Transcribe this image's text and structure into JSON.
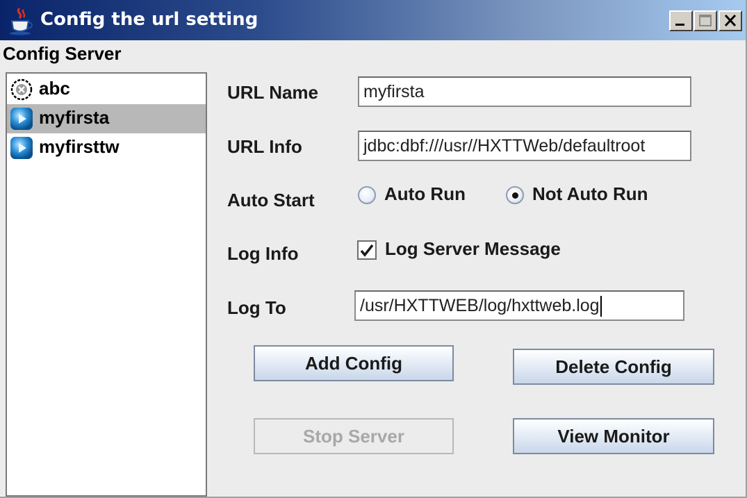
{
  "window": {
    "title": "Config the url setting",
    "icon": "java-cup-icon"
  },
  "server_panel": {
    "label": "Config Server",
    "items": [
      {
        "label": "abc",
        "icon": "stopped-server-icon",
        "selected": false
      },
      {
        "label": "myfirsta",
        "icon": "running-server-icon",
        "selected": true
      },
      {
        "label": "myfirsttw",
        "icon": "running-server-icon",
        "selected": false
      }
    ]
  },
  "form": {
    "url_name_label": "URL Name",
    "url_name_value": "myfirsta",
    "url_info_label": "URL Info",
    "url_info_value": "jdbc:dbf:///usr//HXTTWeb/defaultroot",
    "auto_start_label": "Auto Start",
    "auto_run_label": "Auto Run",
    "not_auto_run_label": "Not Auto Run",
    "auto_start_selected": "Not Auto Run",
    "log_info_label": "Log Info",
    "log_server_message_label": "Log Server Message",
    "log_server_message_checked": true,
    "log_to_label": "Log To",
    "log_to_value": "/usr/HXTTWEB/log/hxttweb.log"
  },
  "buttons": {
    "add_config": "Add Config",
    "delete_config": "Delete Config",
    "stop_server": "Stop Server",
    "view_monitor": "View Monitor"
  },
  "colors": {
    "titlebar_start": "#0a246a",
    "titlebar_end": "#a6caf0",
    "selection": "#b8b8b8"
  }
}
